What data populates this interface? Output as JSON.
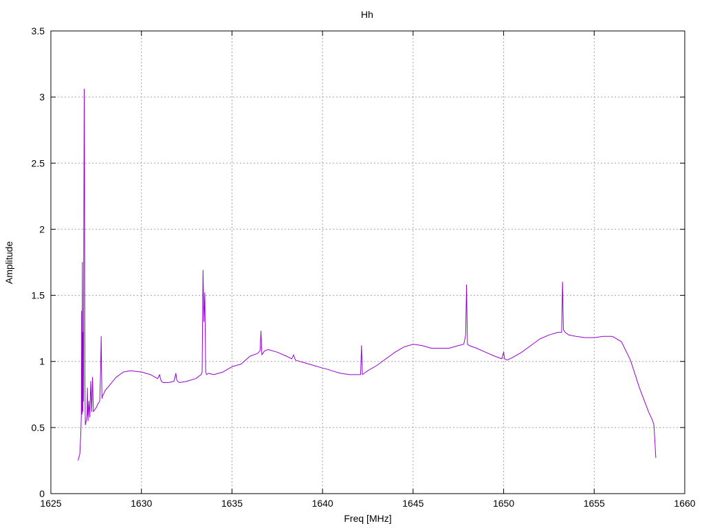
{
  "chart_data": {
    "type": "line",
    "title": "Hh",
    "xlabel": "Freq [MHz]",
    "ylabel": "Amplitude",
    "xlim": [
      1625,
      1660
    ],
    "ylim": [
      0,
      3.5
    ],
    "xticks": [
      1625,
      1630,
      1635,
      1640,
      1645,
      1650,
      1655,
      1660
    ],
    "xtick_labels": [
      "1625",
      "1630",
      "1635",
      "1640",
      "1645",
      "1650",
      "1655",
      "1660"
    ],
    "yticks": [
      0,
      0.5,
      1,
      1.5,
      2,
      2.5,
      3,
      3.5
    ],
    "ytick_labels": [
      "0",
      "0.5",
      "1",
      "1.5",
      "2",
      "2.5",
      "3",
      "3.5"
    ],
    "grid": true,
    "series": [
      {
        "color": "#9400d3",
        "x": [
          1626.5,
          1626.6,
          1626.65,
          1626.68,
          1626.7,
          1626.72,
          1626.74,
          1626.76,
          1626.78,
          1626.8,
          1626.82,
          1626.84,
          1626.86,
          1626.88,
          1626.9,
          1626.95,
          1627.0,
          1627.02,
          1627.05,
          1627.1,
          1627.15,
          1627.2,
          1627.25,
          1627.3,
          1627.35,
          1627.4,
          1627.5,
          1627.6,
          1627.7,
          1627.75,
          1627.78,
          1627.8,
          1627.82,
          1627.85,
          1627.9,
          1628.0,
          1628.3,
          1628.6,
          1629.0,
          1629.4,
          1630.0,
          1630.5,
          1630.9,
          1631.0,
          1631.05,
          1631.1,
          1631.2,
          1631.5,
          1631.8,
          1631.9,
          1631.95,
          1632.0,
          1632.1,
          1632.5,
          1633.0,
          1633.3,
          1633.35,
          1633.4,
          1633.45,
          1633.5,
          1633.55,
          1633.6,
          1633.7,
          1634.0,
          1634.5,
          1635.0,
          1635.5,
          1636.0,
          1636.4,
          1636.55,
          1636.6,
          1636.65,
          1636.7,
          1636.8,
          1637.0,
          1637.5,
          1638.0,
          1638.3,
          1638.4,
          1638.5,
          1639.0,
          1639.5,
          1640.0,
          1640.3,
          1640.5,
          1641.0,
          1641.5,
          1642.0,
          1642.1,
          1642.15,
          1642.2,
          1642.3,
          1642.5,
          1643.0,
          1643.5,
          1644.0,
          1644.5,
          1645.0,
          1645.5,
          1646.0,
          1646.5,
          1647.0,
          1647.5,
          1647.8,
          1647.9,
          1647.95,
          1648.0,
          1648.1,
          1648.5,
          1649.0,
          1649.5,
          1649.9,
          1650.0,
          1650.05,
          1650.2,
          1650.5,
          1651.0,
          1651.5,
          1652.0,
          1652.5,
          1653.0,
          1653.2,
          1653.25,
          1653.3,
          1653.4,
          1653.6,
          1654.0,
          1654.5,
          1655.0,
          1655.5,
          1656.0,
          1656.5,
          1657.0,
          1657.5,
          1658.0,
          1658.2,
          1658.3,
          1658.4
        ],
        "y": [
          0.25,
          0.3,
          0.45,
          0.6,
          1.38,
          0.6,
          1.75,
          0.62,
          1.22,
          0.7,
          2.0,
          3.06,
          2.41,
          0.85,
          0.52,
          0.55,
          0.6,
          0.8,
          0.55,
          0.7,
          0.58,
          0.85,
          0.62,
          0.88,
          0.62,
          0.63,
          0.65,
          0.68,
          0.7,
          0.95,
          1.19,
          0.9,
          0.72,
          0.74,
          0.75,
          0.78,
          0.83,
          0.88,
          0.92,
          0.93,
          0.92,
          0.9,
          0.87,
          0.9,
          0.87,
          0.85,
          0.84,
          0.84,
          0.85,
          0.91,
          0.86,
          0.85,
          0.84,
          0.85,
          0.87,
          0.9,
          0.92,
          1.69,
          1.3,
          1.52,
          0.92,
          0.9,
          0.91,
          0.9,
          0.92,
          0.96,
          0.98,
          1.04,
          1.06,
          1.08,
          1.23,
          1.05,
          1.06,
          1.08,
          1.09,
          1.07,
          1.04,
          1.02,
          1.05,
          1.01,
          0.99,
          0.97,
          0.95,
          0.94,
          0.93,
          0.91,
          0.9,
          0.9,
          0.9,
          1.12,
          0.9,
          0.91,
          0.93,
          0.97,
          1.02,
          1.07,
          1.11,
          1.13,
          1.12,
          1.1,
          1.1,
          1.1,
          1.12,
          1.13,
          1.2,
          1.58,
          1.13,
          1.12,
          1.1,
          1.07,
          1.04,
          1.02,
          1.07,
          1.02,
          1.01,
          1.03,
          1.07,
          1.12,
          1.17,
          1.2,
          1.22,
          1.22,
          1.6,
          1.24,
          1.22,
          1.2,
          1.19,
          1.18,
          1.18,
          1.19,
          1.19,
          1.15,
          1.01,
          0.8,
          0.62,
          0.56,
          0.52,
          0.27
        ]
      }
    ]
  }
}
